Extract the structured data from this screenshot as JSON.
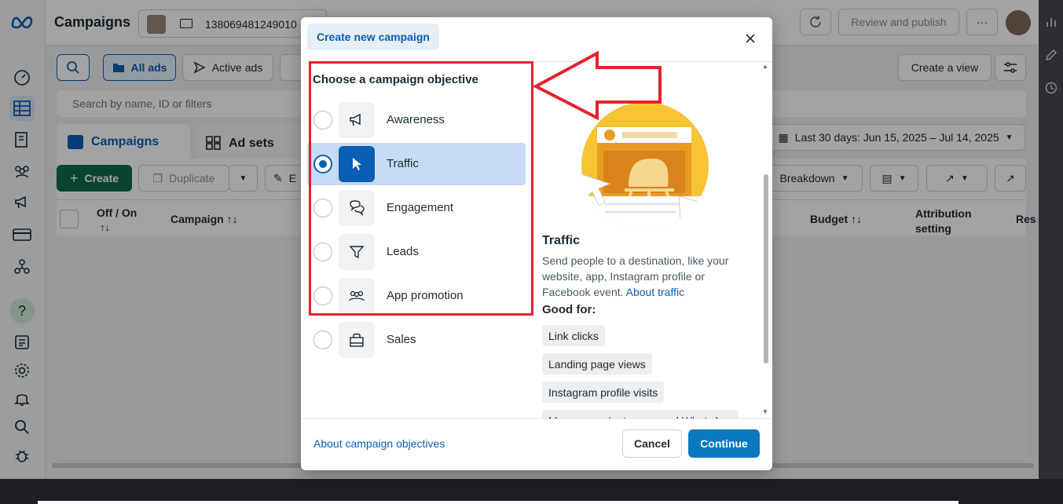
{
  "topbar": {
    "title": "Campaigns",
    "account_id": "138069481249010",
    "review_label": "Review and publish",
    "more_label": "···"
  },
  "toolbar": {
    "all_ads": "All ads",
    "active_ads": "Active ads",
    "create_view": "Create a view",
    "search_placeholder": "Search by name, ID or filters"
  },
  "tabs": {
    "campaigns": "Campaigns",
    "adsets": "Ad sets"
  },
  "actions": {
    "create": "Create",
    "duplicate": "Duplicate",
    "edit_partial": "E",
    "date_range": "Last 30 days: Jun 15, 2025 – Jul 14, 2025",
    "breakdown": "Breakdown"
  },
  "table": {
    "col_offon": "Off / On",
    "col_offon_sort": "↑↓",
    "col_campaign": "Campaign ↑↓",
    "col_budget": "Budget ↑↓",
    "col_attribution": "Attribution setting",
    "col_res_partial": "Res"
  },
  "modal": {
    "title": "Create new campaign",
    "heading": "Choose a campaign objective",
    "objectives": [
      {
        "label": "Awareness",
        "icon": "megaphone-icon",
        "selected": false
      },
      {
        "label": "Traffic",
        "icon": "cursor-icon",
        "selected": true
      },
      {
        "label": "Engagement",
        "icon": "chat-bubbles-icon",
        "selected": false
      },
      {
        "label": "Leads",
        "icon": "funnel-icon",
        "selected": false
      },
      {
        "label": "App promotion",
        "icon": "people-icon",
        "selected": false
      },
      {
        "label": "Sales",
        "icon": "shopping-bag-icon",
        "selected": false
      }
    ],
    "detail": {
      "title": "Traffic",
      "description": "Send people to a destination, like your website, app, Instagram profile or Facebook event.",
      "link": "About traffic",
      "good_for_label": "Good for:",
      "good_for": [
        "Link clicks",
        "Landing page views",
        "Instagram profile visits",
        "Messenger, Instagram and WhatsApp"
      ]
    },
    "footer": {
      "about_link": "About campaign objectives",
      "cancel": "Cancel",
      "continue": "Continue"
    }
  },
  "colors": {
    "accent": "#0a5fb4",
    "primary_button": "#0a78be",
    "annotation_red": "#e3232e",
    "create_green": "#0e6b4b"
  }
}
